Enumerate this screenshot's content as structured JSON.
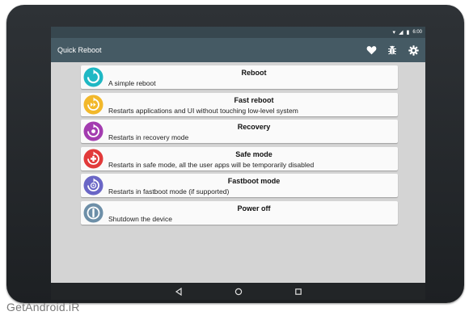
{
  "statusbar": {
    "time": "6:00",
    "wifi_icon": "wifi-icon",
    "signal_icon": "signal-icon",
    "battery_icon": "battery-icon"
  },
  "toolbar": {
    "title": "Quick Reboot",
    "actions": [
      "heart-icon",
      "bug-icon",
      "gear-icon"
    ]
  },
  "items": [
    {
      "title": "Reboot",
      "desc": "A simple reboot",
      "color": "#1fb8c4",
      "icon": "reboot-icon"
    },
    {
      "title": "Fast reboot",
      "desc": "Restarts applications and UI without touching low-level system",
      "color": "#f2b82b",
      "icon": "fast-reboot-icon"
    },
    {
      "title": "Recovery",
      "desc": "Restarts in recovery mode",
      "color": "#a33cb0",
      "icon": "recovery-icon"
    },
    {
      "title": "Safe mode",
      "desc": "Restarts in safe mode, all the user apps will be temporarily disabled",
      "color": "#e23a3a",
      "icon": "safe-mode-icon"
    },
    {
      "title": "Fastboot mode",
      "desc": "Restarts in fastboot mode (if supported)",
      "color": "#6a66c6",
      "icon": "fastboot-icon"
    },
    {
      "title": "Power off",
      "desc": "Shutdown the device",
      "color": "#6d8fa8",
      "icon": "power-off-icon"
    }
  ],
  "navbar": [
    "back-icon",
    "home-icon",
    "recents-icon"
  ],
  "watermark": "GetAndroid.iR"
}
